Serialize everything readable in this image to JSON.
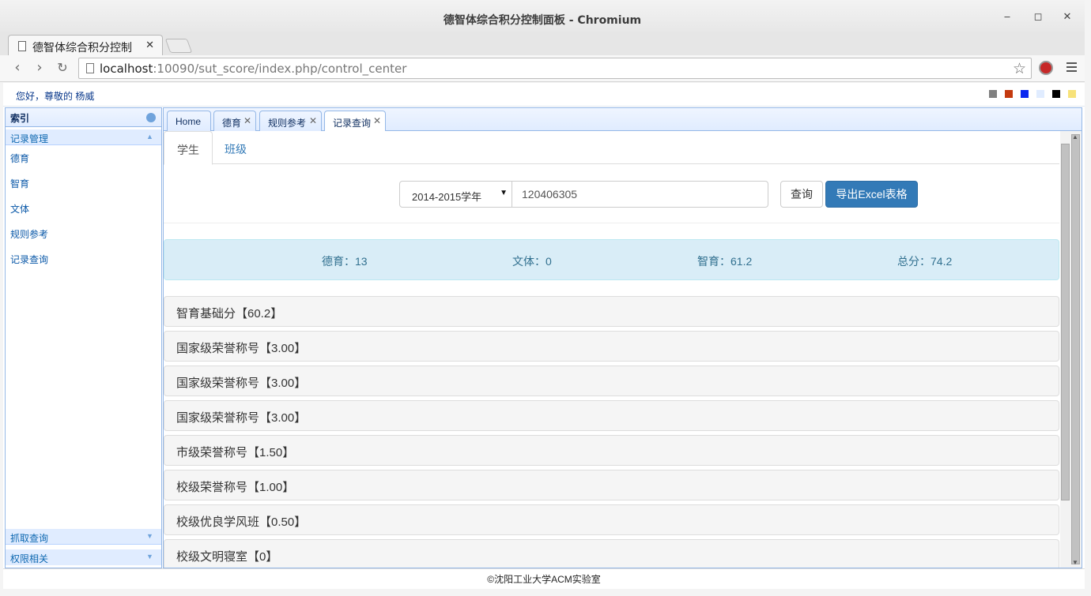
{
  "window": {
    "title": "德智体综合积分控制面板 - Chromium"
  },
  "browser": {
    "tab_title": "德智体综合积分控制",
    "url_host": "localhost",
    "url_rest": ":10090/sut_score/index.php/control_center"
  },
  "header": {
    "greeting": "您好，尊敬的 杨威",
    "theme_colors": [
      "#808080",
      "#c43a0f",
      "#0b28f0",
      "#e0ecff",
      "#000000",
      "#f7e27a"
    ]
  },
  "sidebar": {
    "title": "索引",
    "sections": [
      {
        "label": "记录管理",
        "items": [
          "德育",
          "智育",
          "文体",
          "规则参考",
          "记录查询"
        ]
      },
      {
        "label": "抓取查询"
      },
      {
        "label": "权限相关"
      }
    ]
  },
  "app_tabs": [
    {
      "label": "Home",
      "closable": false
    },
    {
      "label": "德育",
      "closable": true
    },
    {
      "label": "规则参考",
      "closable": true
    },
    {
      "label": "记录查询",
      "closable": true,
      "active": true
    }
  ],
  "record_query": {
    "subtabs": [
      "学生",
      "班级"
    ],
    "year": "2014-2015学年",
    "student_id": "120406305",
    "query_label": "查询",
    "export_label": "导出Excel表格",
    "summary": {
      "moral": "德育：13",
      "sports": "文体：0",
      "intellect": "智育：61.2",
      "total": "总分：74.2"
    },
    "records": [
      "智育基础分【60.2】",
      "国家级荣誉称号【3.00】",
      "国家级荣誉称号【3.00】",
      "国家级荣誉称号【3.00】",
      "市级荣誉称号【1.50】",
      "校级荣誉称号【1.00】",
      "校级优良学风班【0.50】",
      "校级文明寝室【0】"
    ]
  },
  "footer": {
    "text": "©沈阳工业大学ACM实验室"
  }
}
